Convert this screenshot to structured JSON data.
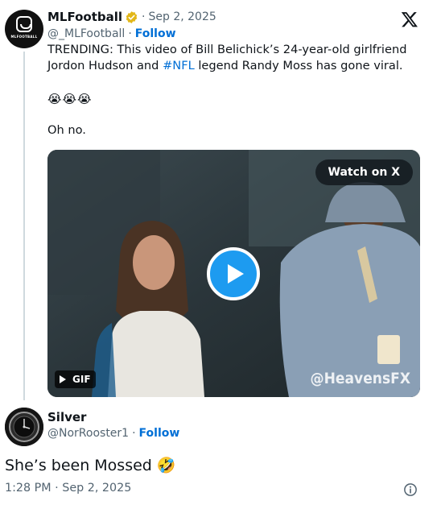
{
  "quoted_tweet": {
    "author_name": "MLFootball",
    "avatar_logo_text": "MLFOOTBALL",
    "separator": "·",
    "date": "Sep 2, 2025",
    "handle": "@_MLFootball",
    "follow_label": "Follow",
    "text_before_hashtag": "TRENDING: This video of Bill Belichick’s 24-year-old girlfriend Jordon Hudson and ",
    "hashtag": "#NFL",
    "text_after_hashtag": " legend Randy Moss has gone viral.",
    "emojis": "😭😭😭",
    "text_line2": "Oh no.",
    "media": {
      "watch_label": "Watch on X",
      "gif_label": "GIF",
      "watermark": "@HeavensFX"
    }
  },
  "reply_tweet": {
    "author_name": "Silver",
    "handle": "@NorRooster1",
    "separator": "·",
    "follow_label": "Follow",
    "text": "She’s been Mossed",
    "emoji": "🤣",
    "timestamp": "1:28 PM · Sep 2, 2025"
  },
  "icons": {
    "verified": "verified-badge-icon",
    "brand": "x-logo-icon",
    "info": "info-icon",
    "play": "play-icon"
  },
  "colors": {
    "link": "#006fd6",
    "muted": "#536471",
    "play_button": "#1d9bf0",
    "verified_gold": "#e2b719"
  }
}
